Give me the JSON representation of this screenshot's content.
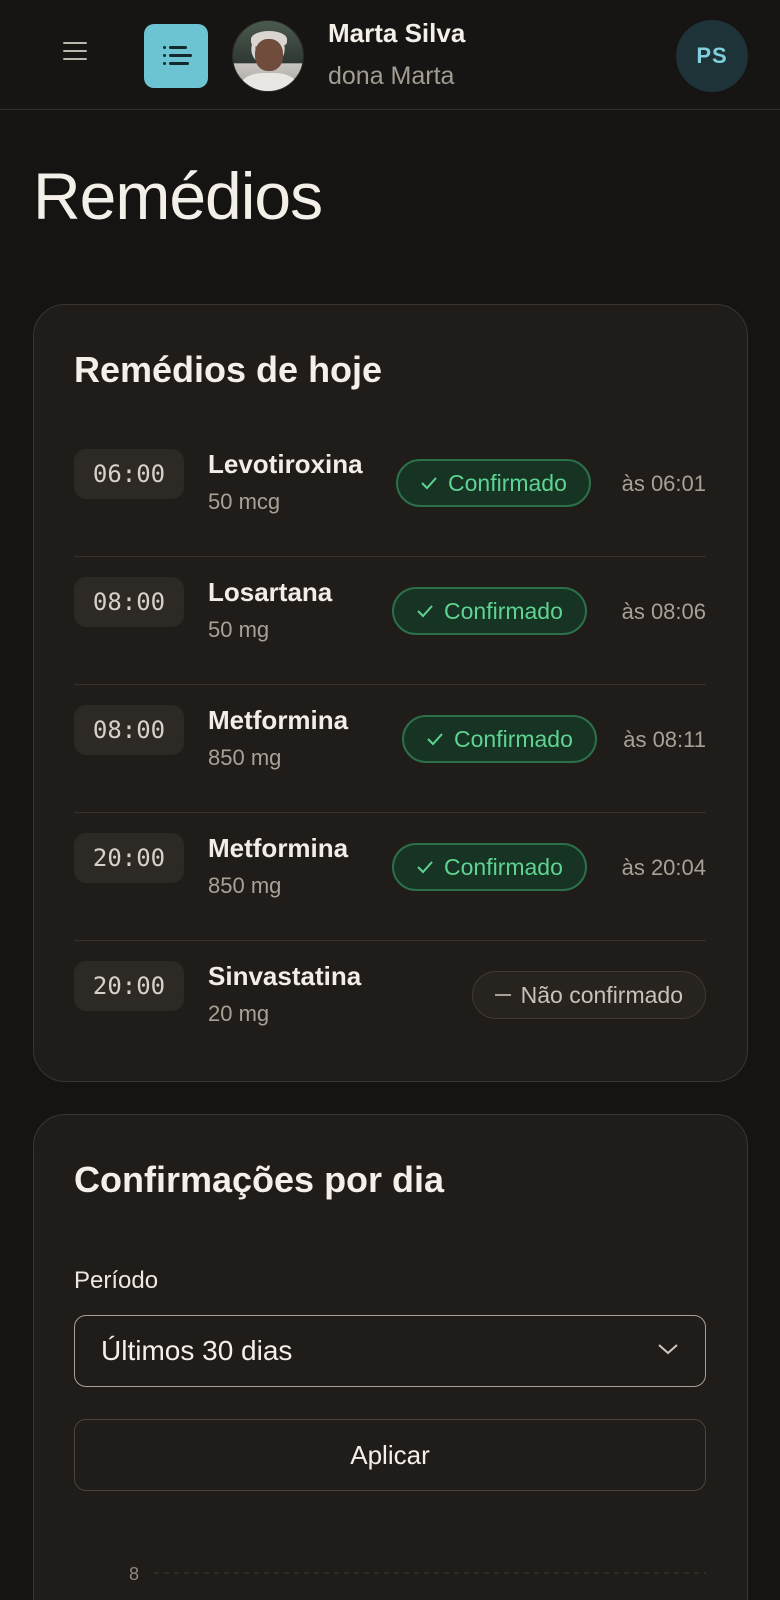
{
  "header": {
    "patient_name": "Marta Silva",
    "patient_nickname": "dona Marta",
    "user_initials": "PS"
  },
  "page": {
    "title": "Remédios"
  },
  "today": {
    "title": "Remédios de hoje",
    "items": [
      {
        "time": "06:00",
        "name": "Levotiroxina",
        "dose": "50 mcg",
        "status": "Confirmado",
        "confirmed_at": "às 06:01"
      },
      {
        "time": "08:00",
        "name": "Losartana",
        "dose": "50 mg",
        "status": "Confirmado",
        "confirmed_at": "às 08:06"
      },
      {
        "time": "08:00",
        "name": "Metformina",
        "dose": "850 mg",
        "status": "Confirmado",
        "confirmed_at": "às 08:11"
      },
      {
        "time": "20:00",
        "name": "Metformina",
        "dose": "850 mg",
        "status": "Confirmado",
        "confirmed_at": "às 20:04"
      },
      {
        "time": "20:00",
        "name": "Sinvastatina",
        "dose": "20 mg",
        "status": "Não confirmado",
        "confirmed_at": ""
      }
    ]
  },
  "confirmations": {
    "title": "Confirmações por dia",
    "period_label": "Período",
    "period_value": "Últimos 30 dias",
    "apply_label": "Aplicar"
  },
  "chart_data": {
    "type": "bar",
    "title": "",
    "xlabel": "",
    "ylabel": "",
    "y_ticks_visible": [
      "8"
    ],
    "grid": true,
    "categories": [],
    "values": []
  },
  "colors": {
    "accent": "#6cc3d1",
    "confirmed": "#5ed491",
    "background": "#161412",
    "card": "#1f1c19"
  }
}
